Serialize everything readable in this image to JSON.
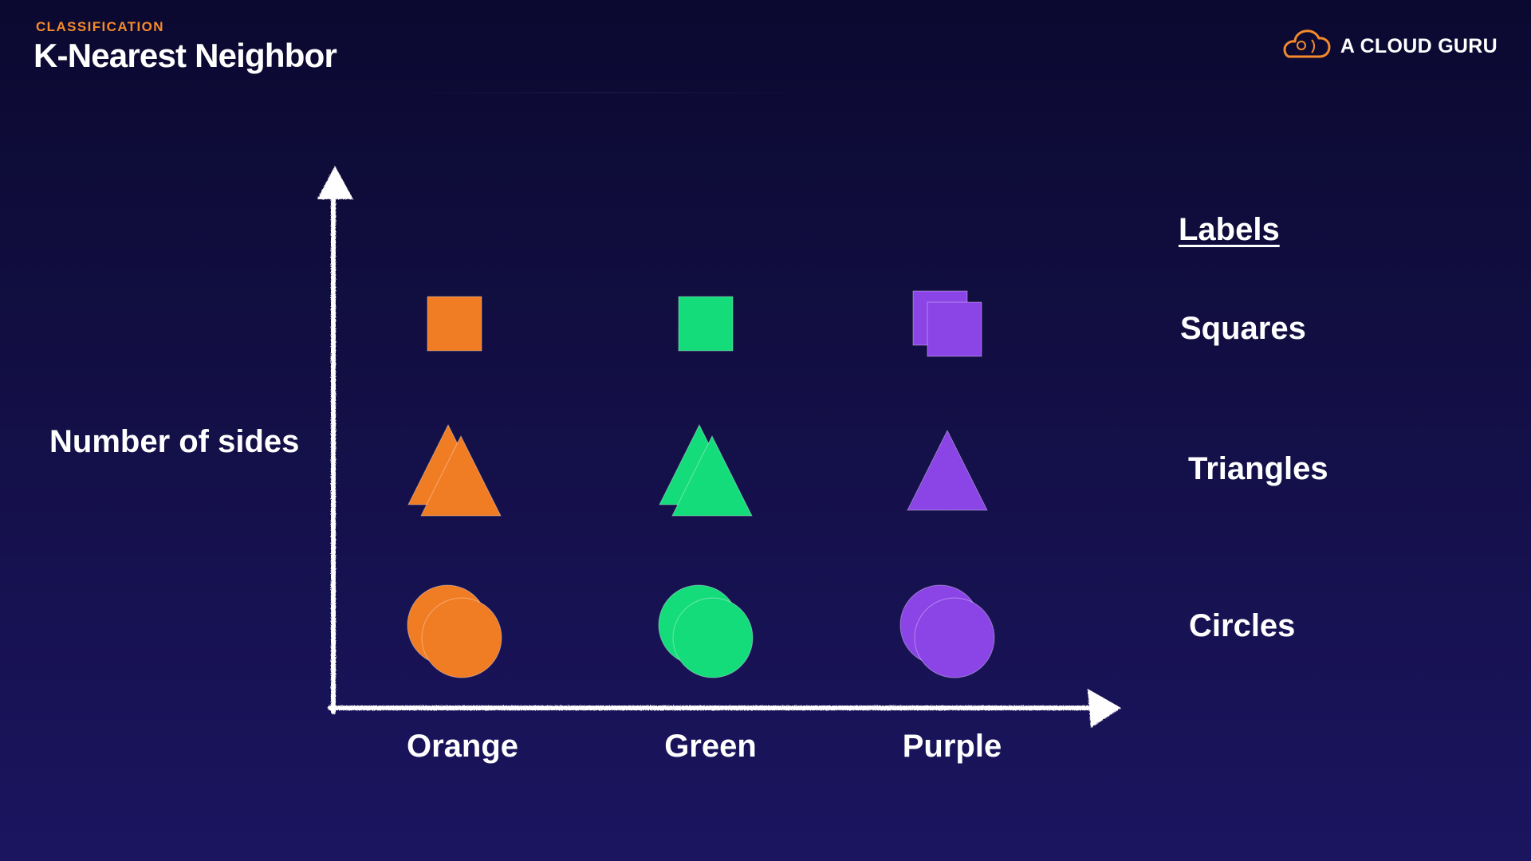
{
  "header": {
    "eyebrow": "CLASSIFICATION",
    "title": "K-Nearest Neighbor",
    "brand": "A CLOUD GURU"
  },
  "colors": {
    "orange": "#f07c24",
    "green": "#14dc7b",
    "purple": "#8b44e6",
    "accent": "#f58a2c",
    "axis": "#ffffff"
  },
  "axes": {
    "y_label": "Number of sides",
    "x_categories": [
      "Orange",
      "Green",
      "Purple"
    ]
  },
  "legend": {
    "heading": "Labels",
    "items": [
      "Squares",
      "Triangles",
      "Circles"
    ]
  },
  "chart_data": {
    "type": "scatter",
    "title": "K-Nearest Neighbor",
    "ylabel": "Number of sides",
    "x_categories": [
      "Orange",
      "Green",
      "Purple"
    ],
    "y_categories": [
      "Circles",
      "Triangles",
      "Squares"
    ],
    "points": [
      {
        "x": "Orange",
        "shape": "square",
        "count": 1
      },
      {
        "x": "Green",
        "shape": "square",
        "count": 1
      },
      {
        "x": "Purple",
        "shape": "square",
        "count": 2
      },
      {
        "x": "Orange",
        "shape": "triangle",
        "count": 2
      },
      {
        "x": "Green",
        "shape": "triangle",
        "count": 2
      },
      {
        "x": "Purple",
        "shape": "triangle",
        "count": 1
      },
      {
        "x": "Orange",
        "shape": "circle",
        "count": 2
      },
      {
        "x": "Green",
        "shape": "circle",
        "count": 2
      },
      {
        "x": "Purple",
        "shape": "circle",
        "count": 2
      }
    ]
  }
}
